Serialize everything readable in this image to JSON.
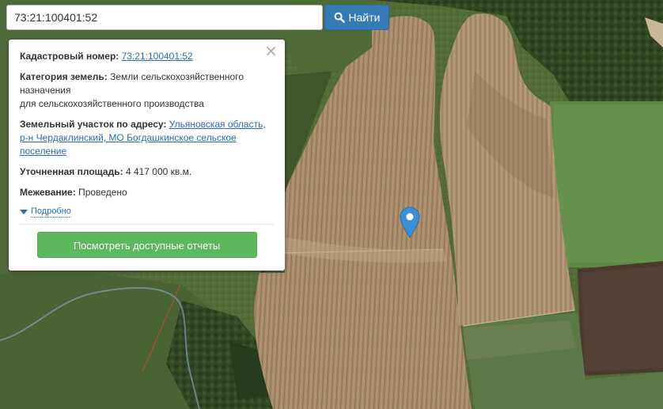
{
  "search": {
    "value": "73:21:100401:52",
    "button_label": "Найти"
  },
  "popup": {
    "cadastral_label": "Кадастровый номер:",
    "cadastral_value": "73:21:100401:52",
    "category_label": "Категория земель:",
    "category_line1": "Земли сельскохозяйственного",
    "category_line2": "назначения",
    "category_line3": "для сельскохозяйственного производства",
    "address_label": "Земельный участок по адресу:",
    "address_line1": "Ульяновская область,",
    "address_line2": "р-н Чердаклинский, МО Богдашкинское сельское",
    "address_line3": "поселение",
    "area_label": "Уточненная площадь:",
    "area_value": "4 417 000 кв.м.",
    "survey_label": "Межевание:",
    "survey_value": "Проведено",
    "details_link": "Подробно",
    "report_button": "Посмотреть доступные отчеты"
  },
  "colors": {
    "search_button": "#337ab7",
    "report_button": "#5cb85c",
    "link": "#2a6db5",
    "marker": "#3a8fd6"
  },
  "icons": {
    "search_button_icon": "search-icon",
    "close": "close-icon",
    "details_toggle": "caret-down-icon",
    "marker": "map-marker-icon"
  }
}
